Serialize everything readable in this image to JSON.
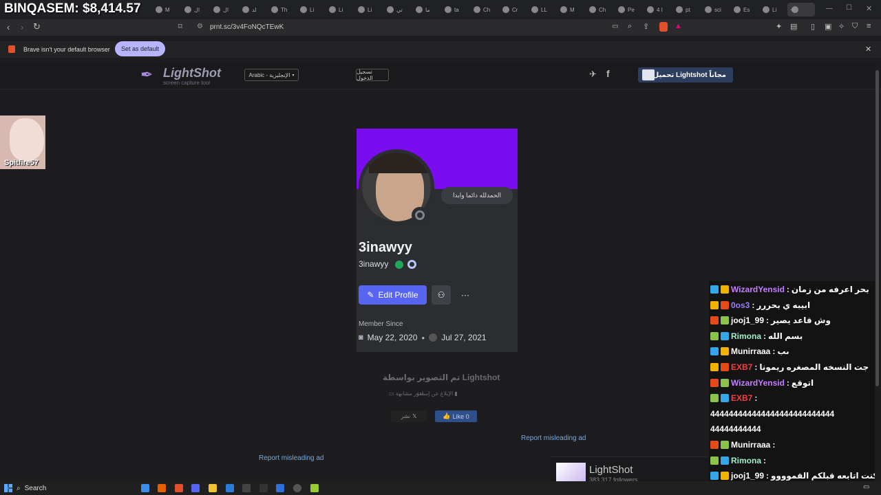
{
  "overlay": {
    "balance": "BINQASEM: $8,414.57"
  },
  "tabs": [
    {
      "label": "M"
    },
    {
      "label": "ال"
    },
    {
      "label": "ال"
    },
    {
      "label": "لد"
    },
    {
      "label": "Th"
    },
    {
      "label": "Li"
    },
    {
      "label": "Li"
    },
    {
      "label": "Li"
    },
    {
      "label": "تي"
    },
    {
      "label": "ما"
    },
    {
      "label": "ta"
    },
    {
      "label": "Ch"
    },
    {
      "label": "Cr"
    },
    {
      "label": "LL"
    },
    {
      "label": "M"
    },
    {
      "label": "Ch"
    },
    {
      "label": "Pe"
    },
    {
      "label": "4 I"
    },
    {
      "label": "pt"
    },
    {
      "label": "sci"
    },
    {
      "label": "Es"
    },
    {
      "label": "Li"
    },
    {
      "label": ""
    }
  ],
  "browser": {
    "url": "prnt.sc/3v4FoNQcTEwK",
    "infobar_message": "Brave isn't your default browser",
    "set_default_label": "Set as default"
  },
  "site": {
    "logo_name": "LightShot",
    "logo_tagline": "screen capture tool",
    "language_select": "Arabic - الإنجليزية",
    "login_label": "تسجيل الدخول",
    "download_label": "تحميل Lightshot مجاناً",
    "capture_caption": "تم التصوير بواسطة Lightshot",
    "report_abuse": "الإبلاغ عن إساءة",
    "similar_images": "صور مشابهة",
    "x_share": "نشر",
    "fb_like": "Like 0",
    "report_ad_1": "Report misleading ad",
    "report_ad_2": "Report misleading ad"
  },
  "profile": {
    "status": "الحمدلله دائما وابدا",
    "display_name": "3inawyy",
    "username": "3inawyy",
    "edit_label": "Edit Profile",
    "member_since_label": "Member Since",
    "discord_date": "May 22, 2020",
    "server_date": "Jul 27, 2021",
    "banner_color": "#7a0cf0"
  },
  "webcam": {
    "name": "Spitfire57"
  },
  "chat": [
    {
      "user": "WizardYensid",
      "msg": "بحر اعرفه من زمان",
      "color": "#c77dff"
    },
    {
      "user": "0os3",
      "msg": "ابيبه ي بحررر",
      "color": "#9d7dff"
    },
    {
      "user": "jooj1_99",
      "msg": "وش قاعد يصير",
      "color": "#ffffff"
    },
    {
      "user": "Rimona",
      "msg": "بسم الله",
      "color": "#9ef0c8"
    },
    {
      "user": "Munirraaa",
      "msg": "ىب",
      "color": "#ffffff"
    },
    {
      "user": "EXB7",
      "msg": "جت النسخه المصغره ريمونا",
      "color": "#ff3b3b"
    },
    {
      "user": "WizardYensid",
      "msg": "اتوقع",
      "color": "#c77dff"
    },
    {
      "user": "EXB7",
      "msg": "",
      "color": "#ff3b3b"
    },
    {
      "user": "",
      "msg": "444444444444444444444444444",
      "color": "#ffffff"
    },
    {
      "user": "",
      "msg": "44444444444",
      "color": "#ffffff"
    },
    {
      "user": "Munirraaa",
      "msg": "",
      "color": "#ffffff"
    },
    {
      "user": "Rimona",
      "msg": "",
      "color": "#9ef0c8"
    },
    {
      "user": "jooj1_99",
      "msg": "كنت اتابعه قبلكم القموووو",
      "color": "#ffffff"
    }
  ],
  "lightshot_widget": {
    "name": "LightShot",
    "followers": "383,317 followers"
  },
  "taskbar": {
    "search_label": "Search"
  }
}
